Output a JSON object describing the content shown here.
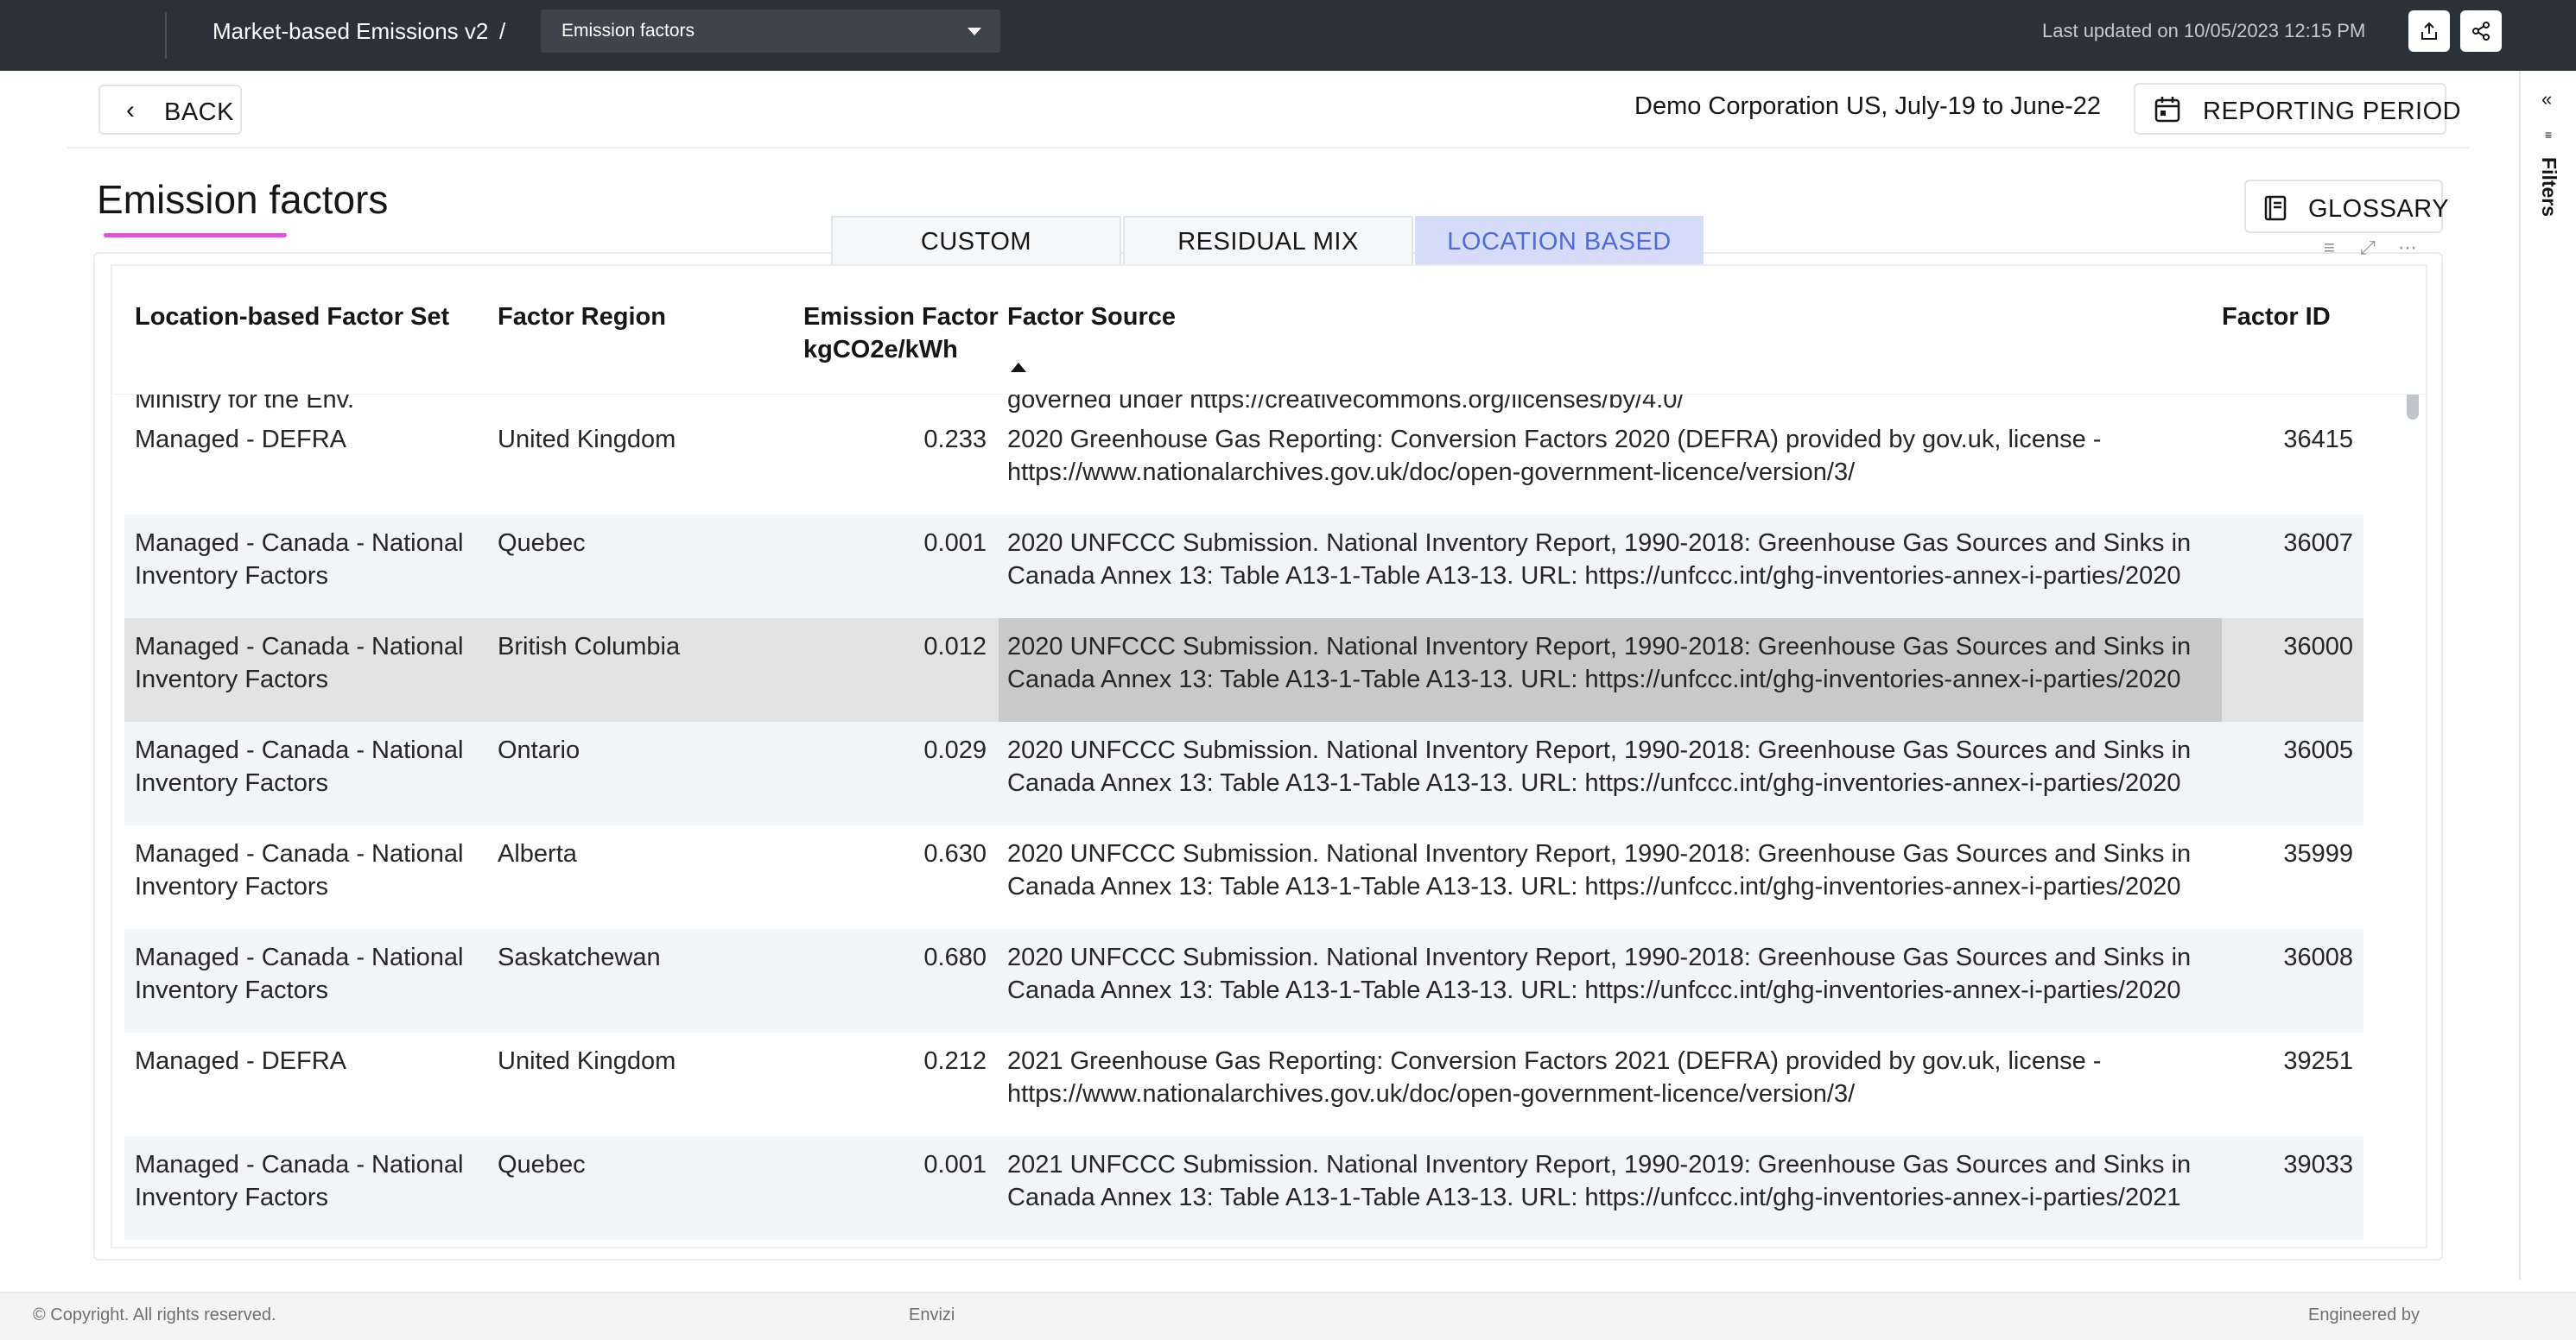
{
  "header": {
    "app_title": "Market-based Emissions v2",
    "crumb_separator": "/",
    "page_select_value": "Emission factors",
    "last_updated": "Last updated on 10/05/2023 12:15 PM",
    "export_icon": "export-icon",
    "share_icon": "share-icon"
  },
  "filters_panel": {
    "collapse_glyph": "«",
    "label": "Filters"
  },
  "toolbar": {
    "back_label": "BACK",
    "org_period": "Demo Corporation US, July-19 to June-22",
    "reporting_period_label": "REPORTING PERIOD",
    "glossary_label": "GLOSSARY"
  },
  "page": {
    "title": "Emission factors",
    "tabs": [
      {
        "label": "CUSTOM",
        "active": false
      },
      {
        "label": "RESIDUAL MIX",
        "active": false
      },
      {
        "label": "LOCATION BASED",
        "active": true
      }
    ]
  },
  "table": {
    "columns": {
      "factor_set": "Location-based Factor Set",
      "region": "Factor Region",
      "ef_line1": "Emission Factor",
      "ef_line2": "kgCO2e/kWh",
      "source": "Factor Source",
      "id": "Factor ID"
    },
    "partial_row": {
      "set": "Ministry for the Env.",
      "source": "governed under https://creativecommons.org/licenses/by/4.0/"
    },
    "rows": [
      {
        "set": "Managed - DEFRA",
        "region": "United Kingdom",
        "ef": "0.233",
        "source": "2020 Greenhouse Gas Reporting: Conversion Factors 2020 (DEFRA) provided by gov.uk, license - https://www.nationalarchives.gov.uk/doc/open-government-licence/version/3/",
        "id": "36415"
      },
      {
        "set": "Managed - Canada - National Inventory Factors",
        "region": "Quebec",
        "ef": "0.001",
        "source": "2020 UNFCCC Submission. National Inventory Report, 1990-2018: Greenhouse Gas Sources and Sinks in Canada Annex 13: Table A13-1-Table A13-13. URL: https://unfccc.int/ghg-inventories-annex-i-parties/2020",
        "id": "36007"
      },
      {
        "set": "Managed - Canada - National Inventory Factors",
        "region": "British Columbia",
        "ef": "0.012",
        "source": "2020 UNFCCC Submission. National Inventory Report, 1990-2018: Greenhouse Gas Sources and Sinks in Canada Annex 13: Table A13-1-Table A13-13. URL: https://unfccc.int/ghg-inventories-annex-i-parties/2020",
        "id": "36000"
      },
      {
        "set": "Managed - Canada - National Inventory Factors",
        "region": "Ontario",
        "ef": "0.029",
        "source": "2020 UNFCCC Submission. National Inventory Report, 1990-2018: Greenhouse Gas Sources and Sinks in Canada Annex 13: Table A13-1-Table A13-13. URL: https://unfccc.int/ghg-inventories-annex-i-parties/2020",
        "id": "36005"
      },
      {
        "set": "Managed - Canada - National Inventory Factors",
        "region": "Alberta",
        "ef": "0.630",
        "source": "2020 UNFCCC Submission. National Inventory Report, 1990-2018: Greenhouse Gas Sources and Sinks in Canada Annex 13: Table A13-1-Table A13-13. URL: https://unfccc.int/ghg-inventories-annex-i-parties/2020",
        "id": "35999"
      },
      {
        "set": "Managed - Canada - National Inventory Factors",
        "region": "Saskatchewan",
        "ef": "0.680",
        "source": "2020 UNFCCC Submission. National Inventory Report, 1990-2018: Greenhouse Gas Sources and Sinks in Canada Annex 13: Table A13-1-Table A13-13. URL: https://unfccc.int/ghg-inventories-annex-i-parties/2020",
        "id": "36008"
      },
      {
        "set": "Managed - DEFRA",
        "region": "United Kingdom",
        "ef": "0.212",
        "source": "2021 Greenhouse Gas Reporting: Conversion Factors 2021 (DEFRA) provided by gov.uk, license - https://www.nationalarchives.gov.uk/doc/open-government-licence/version/3/",
        "id": "39251"
      },
      {
        "set": "Managed - Canada - National Inventory Factors",
        "region": "Quebec",
        "ef": "0.001",
        "source": "2021 UNFCCC Submission. National Inventory Report, 1990-2019: Greenhouse Gas Sources and Sinks in Canada Annex 13: Table A13-1-Table A13-13. URL: https://unfccc.int/ghg-inventories-annex-i-parties/2021",
        "id": "39033"
      }
    ]
  },
  "footer": {
    "copyright": "© Copyright. All rights reserved.",
    "brand": "Envizi",
    "engineered_by": "Engineered by"
  },
  "colors": {
    "topbar": "#2b3138",
    "accent_underline": "#e052e6",
    "active_tab_bg": "#d5dcf9",
    "active_tab_text": "#4f6adf",
    "row_alt": "#f2f4f8",
    "row_selected": "#e3e3e3"
  }
}
